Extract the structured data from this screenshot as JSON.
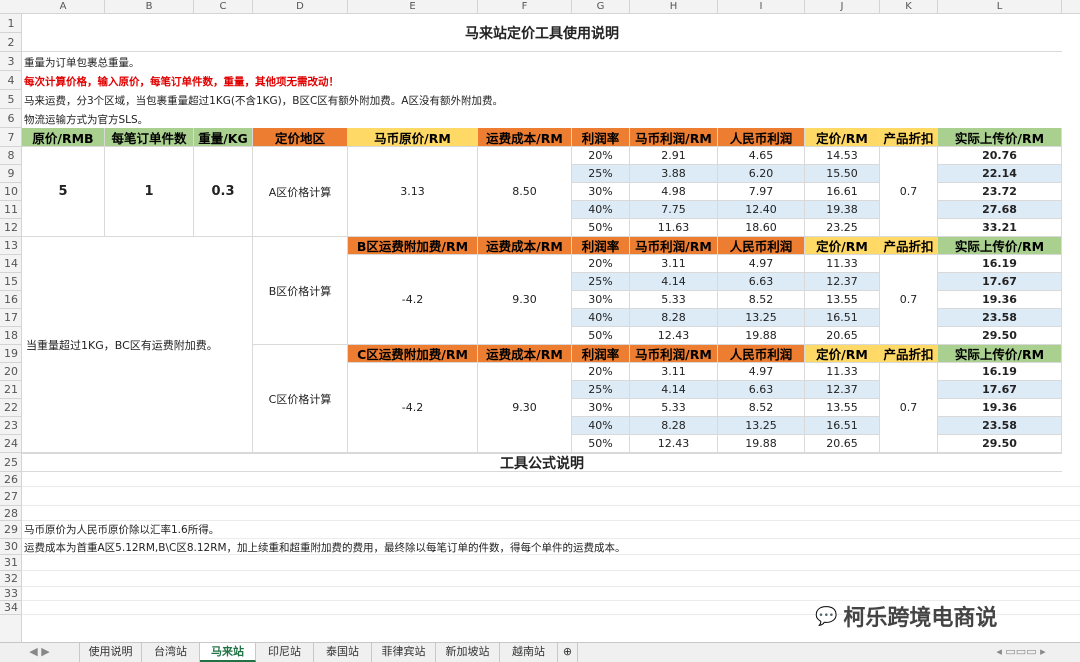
{
  "columns": [
    "A",
    "B",
    "C",
    "D",
    "E",
    "F",
    "G",
    "H",
    "I",
    "J",
    "K",
    "L"
  ],
  "rows": [
    "1",
    "2",
    "3",
    "4",
    "5",
    "6",
    "7",
    "8",
    "9",
    "10",
    "11",
    "12",
    "13",
    "14",
    "15",
    "16",
    "17",
    "18",
    "19",
    "20",
    "21",
    "22",
    "23",
    "24",
    "25",
    "26",
    "27",
    "28",
    "29",
    "30",
    "31",
    "32",
    "33",
    "34"
  ],
  "title": "马来站定价工具使用说明",
  "notes": {
    "n1": "重量为订单包裹总重量。",
    "n2": "每次计算价格，输入原价，每笔订单件数，重量，其他项无需改动！",
    "n3": "马来运费，分3个区域，当包裹重量超过1KG(不含1KG)，B区C区有额外附加费。A区没有额外附加费。",
    "n4": "物流运输方式为官方SLS。"
  },
  "headers": {
    "orig_price": "原价/RMB",
    "pieces": "每笔订单件数",
    "weight": "重量/KG",
    "region": "定价地区",
    "myr_price": "马币原价/RM",
    "ship_cost": "运费成本/RM",
    "margin": "利润率",
    "myr_profit": "马币利润/RM",
    "rmb_profit": "人民币利润",
    "price": "定价/RM",
    "discount": "产品折扣",
    "upload": "实际上传价/RM",
    "b_surcharge": "B区运费附加费/RM",
    "c_surcharge": "C区运费附加费/RM"
  },
  "inputs": {
    "orig": "5",
    "pieces": "1",
    "weight": "0.3"
  },
  "side_note": "当重量超过1KG，BC区有运费附加费。",
  "zones": [
    {
      "label": "A区价格计算",
      "e": "3.13",
      "f": "8.50",
      "k": "0.7",
      "rows": [
        [
          "20%",
          "2.91",
          "4.65",
          "14.53",
          "20.76"
        ],
        [
          "25%",
          "3.88",
          "6.20",
          "15.50",
          "22.14"
        ],
        [
          "30%",
          "4.98",
          "7.97",
          "16.61",
          "23.72"
        ],
        [
          "40%",
          "7.75",
          "12.40",
          "19.38",
          "27.68"
        ],
        [
          "50%",
          "11.63",
          "18.60",
          "23.25",
          "33.21"
        ]
      ]
    },
    {
      "label": "B区价格计算",
      "e": "-4.2",
      "f": "9.30",
      "k": "0.7",
      "rows": [
        [
          "20%",
          "3.11",
          "4.97",
          "11.33",
          "16.19"
        ],
        [
          "25%",
          "4.14",
          "6.63",
          "12.37",
          "17.67"
        ],
        [
          "30%",
          "5.33",
          "8.52",
          "13.55",
          "19.36"
        ],
        [
          "40%",
          "8.28",
          "13.25",
          "16.51",
          "23.58"
        ],
        [
          "50%",
          "12.43",
          "19.88",
          "20.65",
          "29.50"
        ]
      ]
    },
    {
      "label": "C区价格计算",
      "e": "-4.2",
      "f": "9.30",
      "k": "0.7",
      "rows": [
        [
          "20%",
          "3.11",
          "4.97",
          "11.33",
          "16.19"
        ],
        [
          "25%",
          "4.14",
          "6.63",
          "12.37",
          "17.67"
        ],
        [
          "30%",
          "5.33",
          "8.52",
          "13.55",
          "19.36"
        ],
        [
          "40%",
          "8.28",
          "13.25",
          "16.51",
          "23.58"
        ],
        [
          "50%",
          "12.43",
          "19.88",
          "20.65",
          "29.50"
        ]
      ]
    }
  ],
  "formula_title": "工具公式说明",
  "formula_notes": {
    "f1": "马币原价为人民币原价除以汇率1.6所得。",
    "f2": "运费成本为首重A区5.12RM,B\\C区8.12RM，加上续重和超重附加费的费用，最终除以每笔订单的件数，得每个单件的运费成本。"
  },
  "watermark": "柯乐跨境电商说",
  "sheet_tabs": [
    "使用说明",
    "台湾站",
    "马来站",
    "印尼站",
    "泰国站",
    "菲律宾站",
    "新加坡站",
    "越南站"
  ],
  "active_tab": "马来站"
}
